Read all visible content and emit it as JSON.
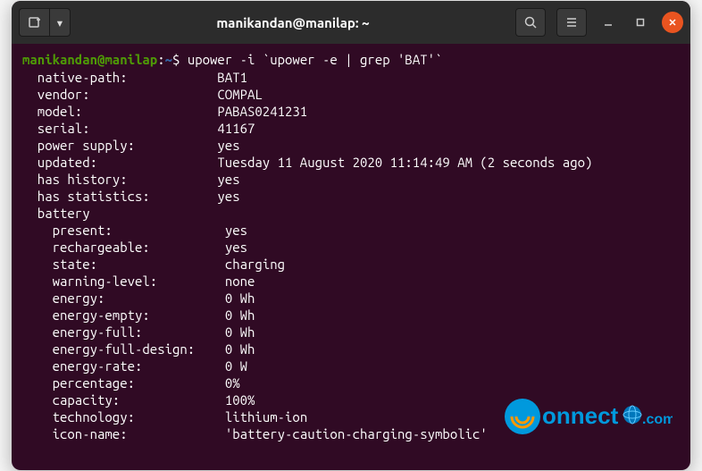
{
  "titlebar": {
    "title": "manikandan@manilap: ~"
  },
  "prompt": {
    "userhost": "manikandan@manilap",
    "path": "~",
    "command": "upower -i `upower -e | grep 'BAT'`"
  },
  "output": {
    "top": [
      {
        "key": "  native-path:",
        "val": "BAT1"
      },
      {
        "key": "  vendor:",
        "val": "COMPAL"
      },
      {
        "key": "  model:",
        "val": "PABAS0241231"
      },
      {
        "key": "  serial:",
        "val": "41167"
      },
      {
        "key": "  power supply:",
        "val": "yes"
      },
      {
        "key": "  updated:",
        "val": "Tuesday 11 August 2020 11:14:49 AM (2 seconds ago)"
      },
      {
        "key": "  has history:",
        "val": "yes"
      },
      {
        "key": "  has statistics:",
        "val": "yes"
      }
    ],
    "section_header": "  battery",
    "battery": [
      {
        "key": "    present:",
        "val": "yes"
      },
      {
        "key": "    rechargeable:",
        "val": "yes"
      },
      {
        "key": "    state:",
        "val": "charging"
      },
      {
        "key": "    warning-level:",
        "val": "none"
      },
      {
        "key": "    energy:",
        "val": "0 Wh"
      },
      {
        "key": "    energy-empty:",
        "val": "0 Wh"
      },
      {
        "key": "    energy-full:",
        "val": "0 Wh"
      },
      {
        "key": "    energy-full-design:",
        "val": "0 Wh"
      },
      {
        "key": "    energy-rate:",
        "val": "0 W"
      },
      {
        "key": "    percentage:",
        "val": "0%"
      },
      {
        "key": "    capacity:",
        "val": "100%"
      },
      {
        "key": "    technology:",
        "val": "lithium-ion"
      },
      {
        "key": "    icon-name:",
        "val": "'battery-caution-charging-symbolic'"
      }
    ]
  },
  "icons": {
    "newtab": "⊞",
    "dropdown": "▾",
    "search": "🔍",
    "menu": "≡",
    "minimize": "—",
    "maximize": "□",
    "close": "✕"
  },
  "watermark": {
    "text1": "onnect",
    "text2": ".com"
  }
}
